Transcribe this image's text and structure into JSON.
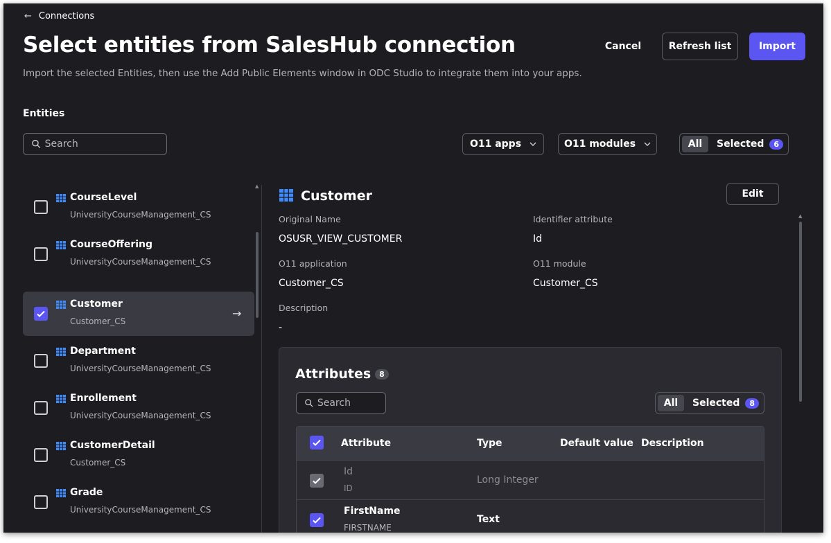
{
  "header": {
    "back_label": "Connections",
    "title": "Select entities from SalesHub connection",
    "subtitle": "Import the selected Entities, then use the Add Public Elements window in ODC Studio to integrate them into your apps.",
    "cancel_label": "Cancel",
    "refresh_label": "Refresh list",
    "import_label": "Import"
  },
  "accent_color": "#5b55f2",
  "entities_section": {
    "label": "Entities",
    "search_placeholder": "Search",
    "filter_apps": "O11 apps",
    "filter_modules": "O11 modules",
    "toggle_all": "All",
    "toggle_selected": "Selected",
    "selected_count": "6"
  },
  "entities": [
    {
      "name": "CourseLevel",
      "module": "UniversityCourseManagement_CS",
      "checked": false
    },
    {
      "name": "CourseOffering",
      "module": "UniversityCourseManagement_CS",
      "checked": false
    },
    {
      "name": "Customer",
      "module": "Customer_CS",
      "checked": true
    },
    {
      "name": "Department",
      "module": "UniversityCourseManagement_CS",
      "checked": false
    },
    {
      "name": "Enrollement",
      "module": "UniversityCourseManagement_CS",
      "checked": false
    },
    {
      "name": "CustomerDetail",
      "module": "Customer_CS",
      "checked": false
    },
    {
      "name": "Grade",
      "module": "UniversityCourseManagement_CS",
      "checked": false
    }
  ],
  "detail": {
    "title": "Customer",
    "edit_label": "Edit",
    "original_name_label": "Original Name",
    "original_name": "OSUSR_VIEW_CUSTOMER",
    "identifier_label": "Identifier attribute",
    "identifier": "Id",
    "app_label": "O11 application",
    "app": "Customer_CS",
    "module_label": "O11 module",
    "module": "Customer_CS",
    "description_label": "Description",
    "description": "-"
  },
  "attributes": {
    "title": "Attributes",
    "count": "8",
    "search_placeholder": "Search",
    "toggle_all": "All",
    "toggle_selected": "Selected",
    "selected_count": "8",
    "columns": [
      "Attribute",
      "Type",
      "Default value",
      "Description"
    ],
    "rows": [
      {
        "name": "Id",
        "key": "ID",
        "type": "Long Integer",
        "disabled": true
      },
      {
        "name": "FirstName",
        "key": "FIRSTNAME",
        "type": "Text",
        "disabled": false
      }
    ]
  }
}
